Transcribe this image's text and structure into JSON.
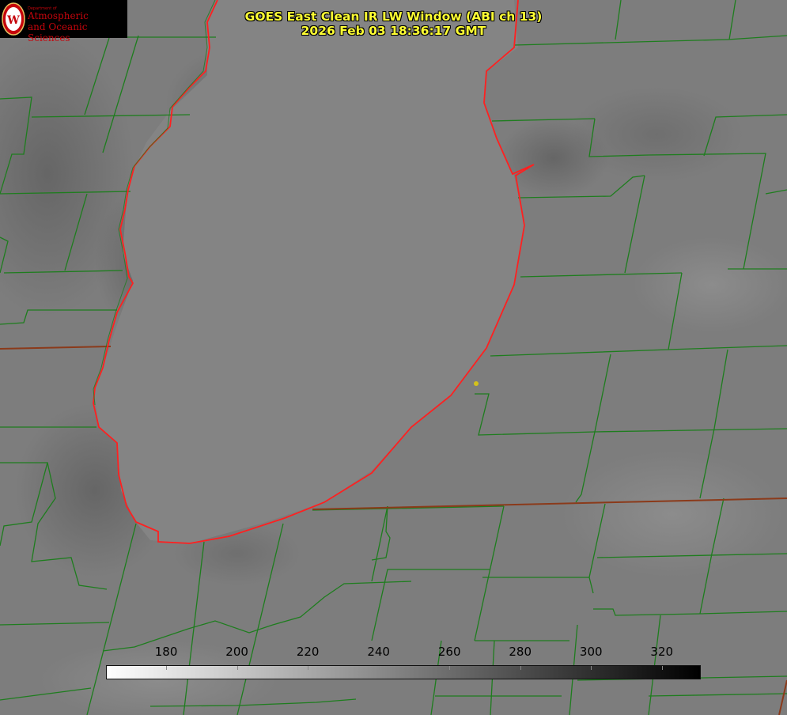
{
  "logo": {
    "small_text": "Department of",
    "line1": "Atmospheric",
    "line2": "and Oceanic Sciences"
  },
  "title": {
    "line1": "GOES East Clean IR LW Window (ABI ch 13)",
    "line2": "2026 Feb 03 18:36:17 GMT"
  },
  "colorbar": {
    "ticks": [
      "180",
      "200",
      "220",
      "240",
      "260",
      "280",
      "300",
      "320"
    ],
    "tick_values": [
      180,
      200,
      220,
      240,
      260,
      280,
      300,
      320
    ],
    "range": [
      163,
      331
    ],
    "gradient": [
      "#ffffff",
      "#000000"
    ]
  },
  "colors": {
    "county_lines": "#1e7d1e",
    "shoreline": "#ff2020",
    "state_line": "#8b3a1a",
    "title_text": "#ffff33",
    "logo_red": "#c5050c",
    "marker": "#d4c21a"
  }
}
